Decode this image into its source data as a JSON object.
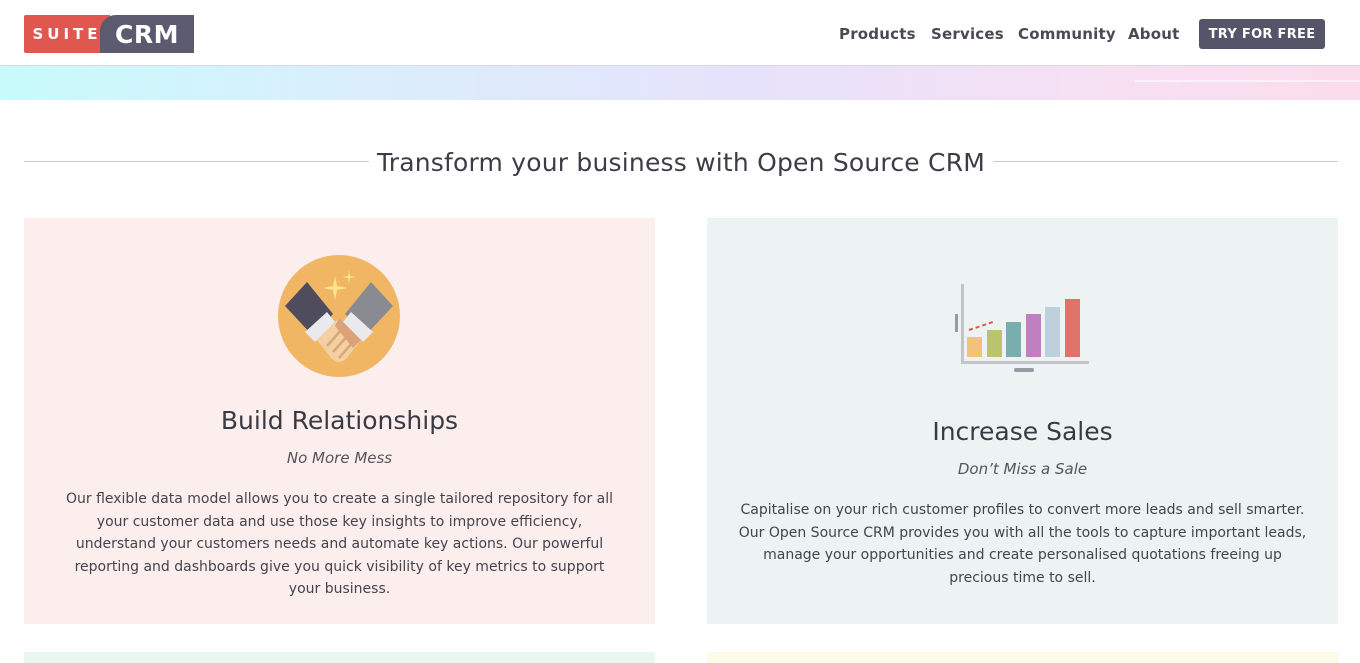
{
  "header": {
    "logo": {
      "suite": "SUITE",
      "crm": "CRM"
    },
    "nav": [
      {
        "label": "Products"
      },
      {
        "label": "Services"
      },
      {
        "label": "Community"
      },
      {
        "label": "About"
      }
    ],
    "cta_label": "TRY FOR FREE"
  },
  "section": {
    "title": "Transform your business with Open Source CRM"
  },
  "cards": [
    {
      "icon": "handshake-icon",
      "title": "Build Relationships",
      "subtitle": "No More Mess",
      "body": "Our flexible data model allows you to create a single tailored repository for all your customer data and use those key insights to improve efficiency, understand your customers needs and automate key actions. Our powerful reporting and dashboards give you quick visibility of key metrics to support your business."
    },
    {
      "icon": "bar-chart-icon",
      "title": "Increase Sales",
      "subtitle": "Don’t Miss a Sale",
      "body": "Capitalise on your rich customer profiles to convert more leads and sell smarter. Our Open Source CRM provides you with all the tools to capture important leads, manage your opportunities and create personalised quotations freeing up precious time to sell."
    }
  ],
  "colors": {
    "brand_red": "#e0574f",
    "brand_dark": "#5c5a6f",
    "card_left_bg": "#fbeeec",
    "card_right_bg": "#ecf3f2"
  }
}
